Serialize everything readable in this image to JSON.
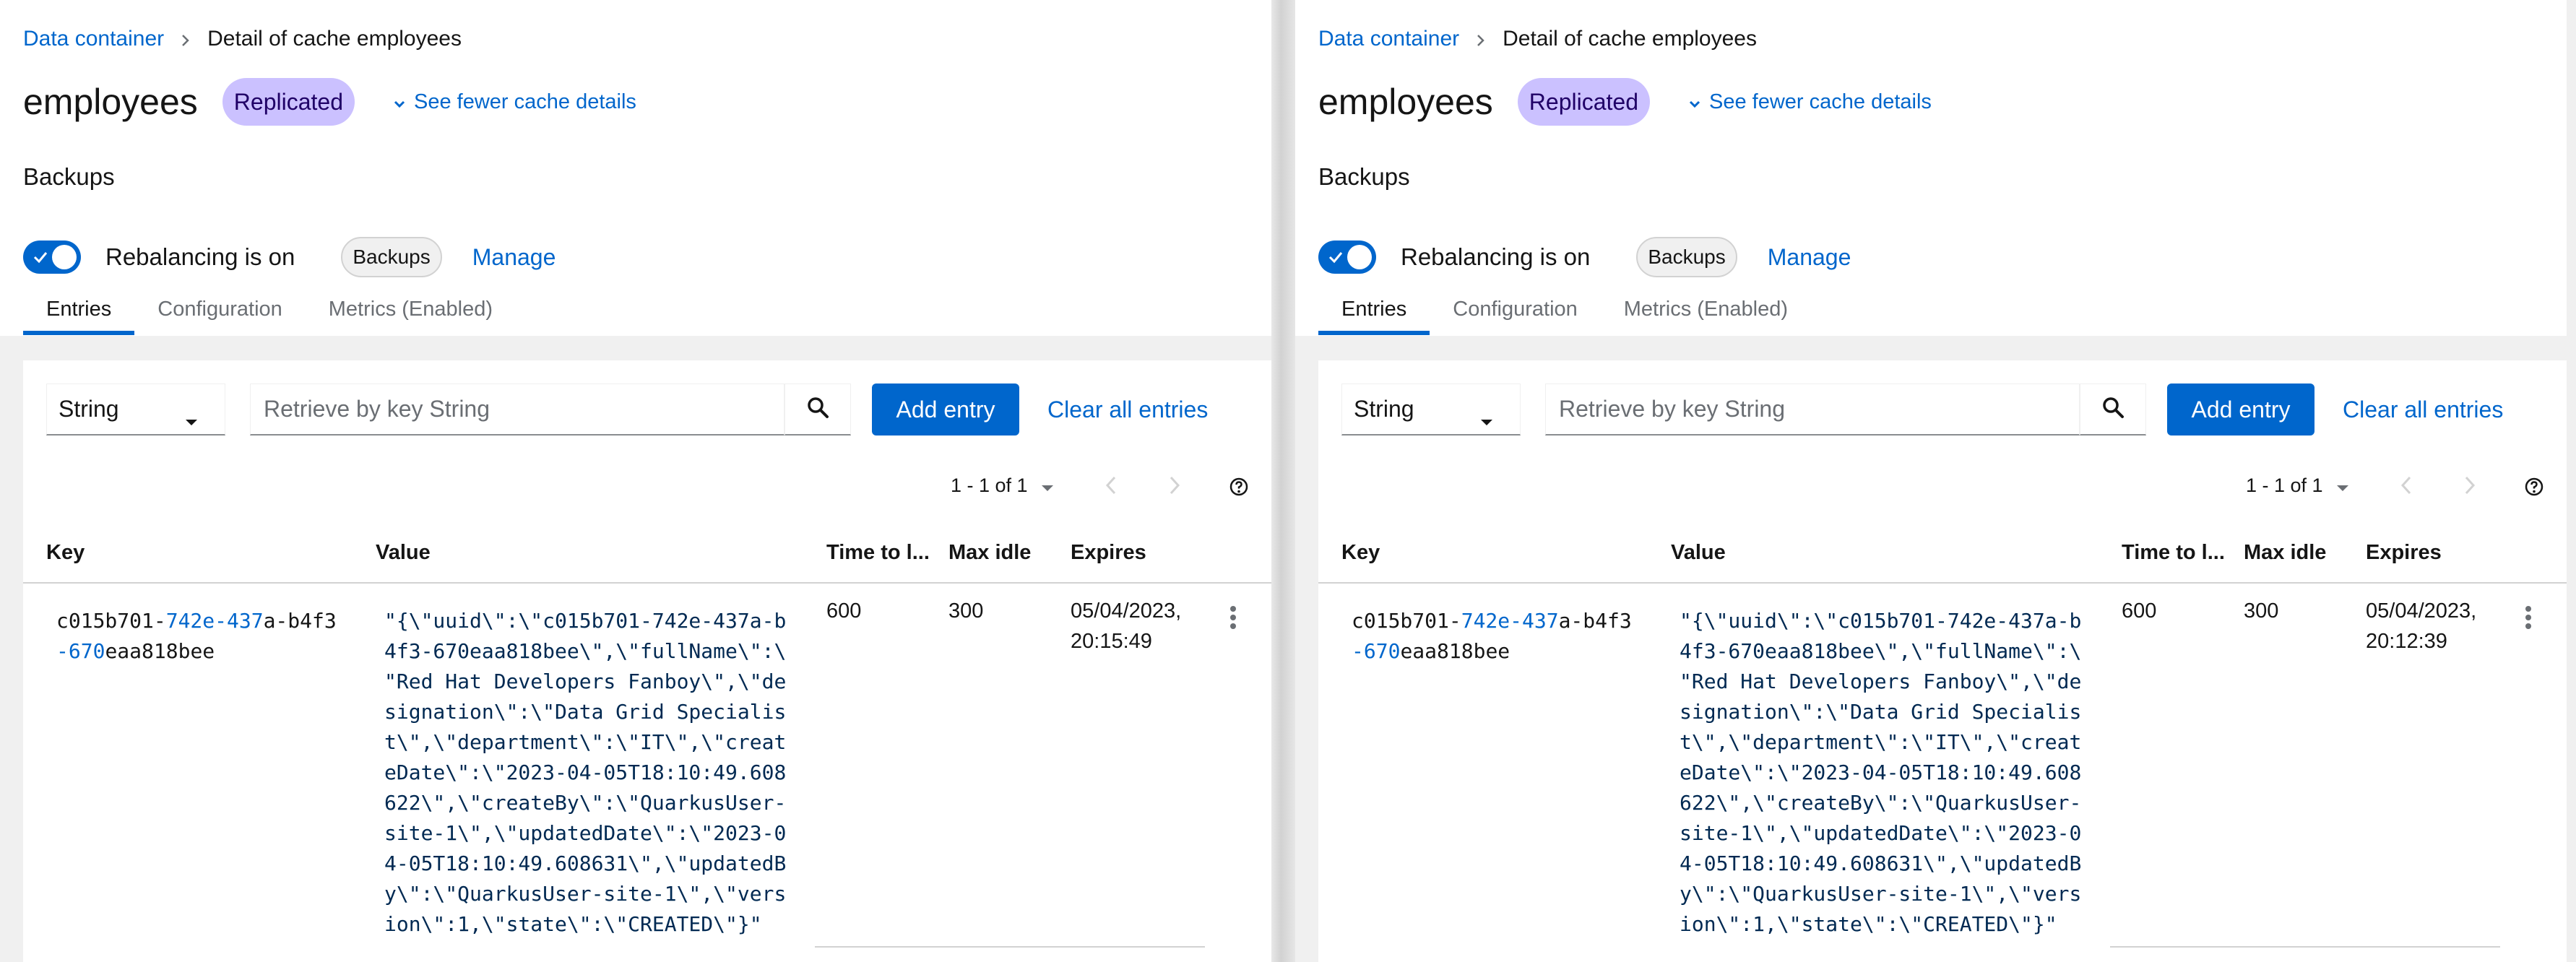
{
  "panels": [
    {
      "breadcrumb": {
        "parent": "Data container",
        "current": "Detail of cache employees"
      },
      "title": "employees",
      "badge": "Replicated",
      "details_toggle": "See fewer cache details",
      "section": "Backups",
      "rebalancing_label": "Rebalancing is on",
      "chip": "Backups",
      "manage": "Manage",
      "tabs": [
        "Entries",
        "Configuration",
        "Metrics (Enabled)"
      ],
      "toolbar": {
        "type": "String",
        "search_placeholder": "Retrieve by key String",
        "add": "Add entry",
        "clear": "Clear all entries"
      },
      "pagination": "1 - 1 of 1",
      "columns": [
        "Key",
        "Value",
        "Time to l...",
        "Max idle",
        "Expires"
      ],
      "row": {
        "key_lines": [
          [
            "c015b701-",
            "742e-437",
            "a-b4f3"
          ],
          [
            "-670",
            "eaa818bee",
            ""
          ]
        ],
        "value_lines": [
          "\"{\\\"uuid\\\":\\\"c015b701-742e-437a-b",
          "4f3-670eaa818bee\\\",\\\"fullName\\\":\\",
          "\"Red Hat Developers Fanboy\\\",\\\"de",
          "signation\\\":\\\"Data Grid Specialis",
          "t\\\",\\\"department\\\":\\\"IT\\\",\\\"creat",
          "eDate\\\":\\\"2023-04-05T18:10:49.608",
          "622\\\",\\\"createBy\\\":\\\"QuarkusUser-",
          "site-1\\\",\\\"updatedDate\\\":\\\"2023-0",
          "4-05T18:10:49.608631\\\",\\\"updatedB",
          "y\\\":\\\"QuarkusUser-site-1\\\",\\\"vers",
          "ion\\\":1,\\\"state\\\":\\\"CREATED\\\"}\""
        ],
        "ttl": "600",
        "max_idle": "300",
        "expires_date": "05/04/2023,",
        "expires_time": "20:15:49"
      }
    },
    {
      "breadcrumb": {
        "parent": "Data container",
        "current": "Detail of cache employees"
      },
      "title": "employees",
      "badge": "Replicated",
      "details_toggle": "See fewer cache details",
      "section": "Backups",
      "rebalancing_label": "Rebalancing is on",
      "chip": "Backups",
      "manage": "Manage",
      "tabs": [
        "Entries",
        "Configuration",
        "Metrics (Enabled)"
      ],
      "toolbar": {
        "type": "String",
        "search_placeholder": "Retrieve by key String",
        "add": "Add entry",
        "clear": "Clear all entries"
      },
      "pagination": "1 - 1 of 1",
      "columns": [
        "Key",
        "Value",
        "Time to l...",
        "Max idle",
        "Expires"
      ],
      "row": {
        "key_lines": [
          [
            "c015b701-",
            "742e-437",
            "a-b4f3"
          ],
          [
            "-670",
            "eaa818bee",
            ""
          ]
        ],
        "value_lines": [
          "\"{\\\"uuid\\\":\\\"c015b701-742e-437a-b",
          "4f3-670eaa818bee\\\",\\\"fullName\\\":\\",
          "\"Red Hat Developers Fanboy\\\",\\\"de",
          "signation\\\":\\\"Data Grid Specialis",
          "t\\\",\\\"department\\\":\\\"IT\\\",\\\"creat",
          "eDate\\\":\\\"2023-04-05T18:10:49.608",
          "622\\\",\\\"createBy\\\":\\\"QuarkusUser-",
          "site-1\\\",\\\"updatedDate\\\":\\\"2023-0",
          "4-05T18:10:49.608631\\\",\\\"updatedB",
          "y\\\":\\\"QuarkusUser-site-1\\\",\\\"vers",
          "ion\\\":1,\\\"state\\\":\\\"CREATED\\\"}\""
        ],
        "ttl": "600",
        "max_idle": "300",
        "expires_date": "05/04/2023,",
        "expires_time": "20:12:39"
      }
    }
  ]
}
